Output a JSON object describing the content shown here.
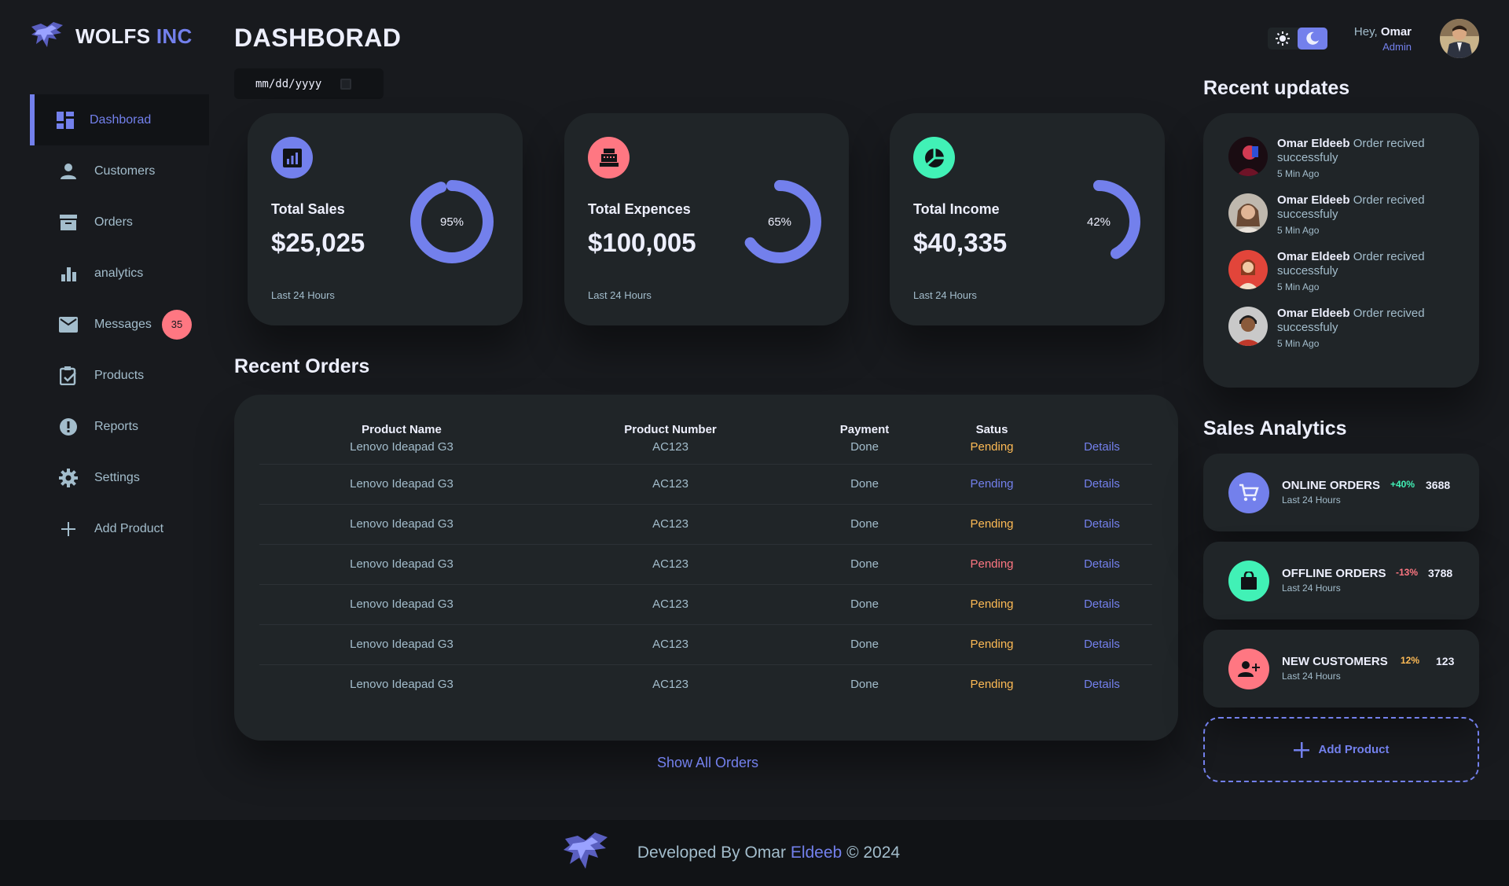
{
  "brand": {
    "name": "WOLFS",
    "accent": "INC"
  },
  "sidebar": {
    "items": [
      {
        "label": "Dashborad",
        "icon": "dashboard-icon"
      },
      {
        "label": "Customers",
        "icon": "person-icon"
      },
      {
        "label": "Orders",
        "icon": "inventory-icon"
      },
      {
        "label": "analytics",
        "icon": "bar-chart-icon"
      },
      {
        "label": "Messages",
        "icon": "mail-icon",
        "badge": "35"
      },
      {
        "label": "Products",
        "icon": "clipboard-check-icon"
      },
      {
        "label": "Reports",
        "icon": "report-icon"
      },
      {
        "label": "Settings",
        "icon": "gear-icon"
      },
      {
        "label": "Add Product",
        "icon": "plus-icon"
      }
    ]
  },
  "header": {
    "title": "DASHBORAD",
    "date_placeholder": "mm/dd/yyyy"
  },
  "insights": [
    {
      "label": "Total Sales",
      "amount": "$25,025",
      "percent": "95%",
      "progress": 0.95,
      "footer": "Last 24 Hours",
      "icon": "analytics-icon"
    },
    {
      "label": "Total Expences",
      "amount": "$100,005",
      "percent": "65%",
      "progress": 0.65,
      "footer": "Last 24 Hours",
      "icon": "cash-register-icon"
    },
    {
      "label": "Total Income",
      "amount": "$40,335",
      "percent": "42%",
      "progress": 0.42,
      "footer": "Last 24 Hours",
      "icon": "pie-chart-icon"
    }
  ],
  "recent_orders": {
    "title": "Recent Orders",
    "columns": [
      "Product Name",
      "Product Number",
      "Payment",
      "Satus"
    ],
    "rows": [
      {
        "name": "Lenovo Ideapad G3",
        "number": "AC123",
        "payment": "Done",
        "status": "Pending",
        "status_color": "#ffbb55",
        "action": "Details"
      },
      {
        "name": "Lenovo Ideapad G3",
        "number": "AC123",
        "payment": "Done",
        "status": "Pending",
        "status_color": "#7380ec",
        "action": "Details"
      },
      {
        "name": "Lenovo Ideapad G3",
        "number": "AC123",
        "payment": "Done",
        "status": "Pending",
        "status_color": "#ffbb55",
        "action": "Details"
      },
      {
        "name": "Lenovo Ideapad G3",
        "number": "AC123",
        "payment": "Done",
        "status": "Pending",
        "status_color": "#ff7782",
        "action": "Details"
      },
      {
        "name": "Lenovo Ideapad G3",
        "number": "AC123",
        "payment": "Done",
        "status": "Pending",
        "status_color": "#ffbb55",
        "action": "Details"
      },
      {
        "name": "Lenovo Ideapad G3",
        "number": "AC123",
        "payment": "Done",
        "status": "Pending",
        "status_color": "#ffbb55",
        "action": "Details"
      },
      {
        "name": "Lenovo Ideapad G3",
        "number": "AC123",
        "payment": "Done",
        "status": "Pending",
        "status_color": "#ffbb55",
        "action": "Details"
      }
    ],
    "show_all": "Show All Orders"
  },
  "profile": {
    "greeting": "Hey,",
    "name": "Omar",
    "role": "Admin"
  },
  "recent_updates": {
    "title": "Recent updates",
    "items": [
      {
        "name": "Omar Eldeeb",
        "text": "Order recived successfuly",
        "time": "5 Min Ago"
      },
      {
        "name": "Omar Eldeeb",
        "text": "Order recived successfuly",
        "time": "5 Min Ago"
      },
      {
        "name": "Omar Eldeeb",
        "text": "Order recived successfuly",
        "time": "5 Min Ago"
      },
      {
        "name": "Omar Eldeeb",
        "text": "Order recived successfuly",
        "time": "5 Min Ago"
      }
    ]
  },
  "sales_analytics": {
    "title": "Sales Analytics",
    "items": [
      {
        "name": "ONLINE ORDERS",
        "sub": "Last 24 Hours",
        "percent": "+40%",
        "value": "3688",
        "color": "#41f1b6",
        "icon": "cart-icon"
      },
      {
        "name": "OFFLINE ORDERS",
        "sub": "Last 24 Hours",
        "percent": "-13%",
        "value": "3788",
        "color": "#ff7782",
        "icon": "shopping-bag-icon"
      },
      {
        "name": "NEW CUSTOMERS",
        "sub": "Last 24 Hours",
        "percent": "12%",
        "value": "123",
        "color": "#ffbb55",
        "icon": "add-person-icon"
      }
    ],
    "add_product": "Add Product"
  },
  "footer": {
    "prefix": "Developed By Omar",
    "accent": "Eldeeb",
    "suffix": "© 2024"
  },
  "colors": {
    "primary": "#7380ec",
    "danger": "#ff7782",
    "success": "#41f1b6",
    "warning": "#ffbb55",
    "background": "#181a1e",
    "card": "#202528"
  }
}
